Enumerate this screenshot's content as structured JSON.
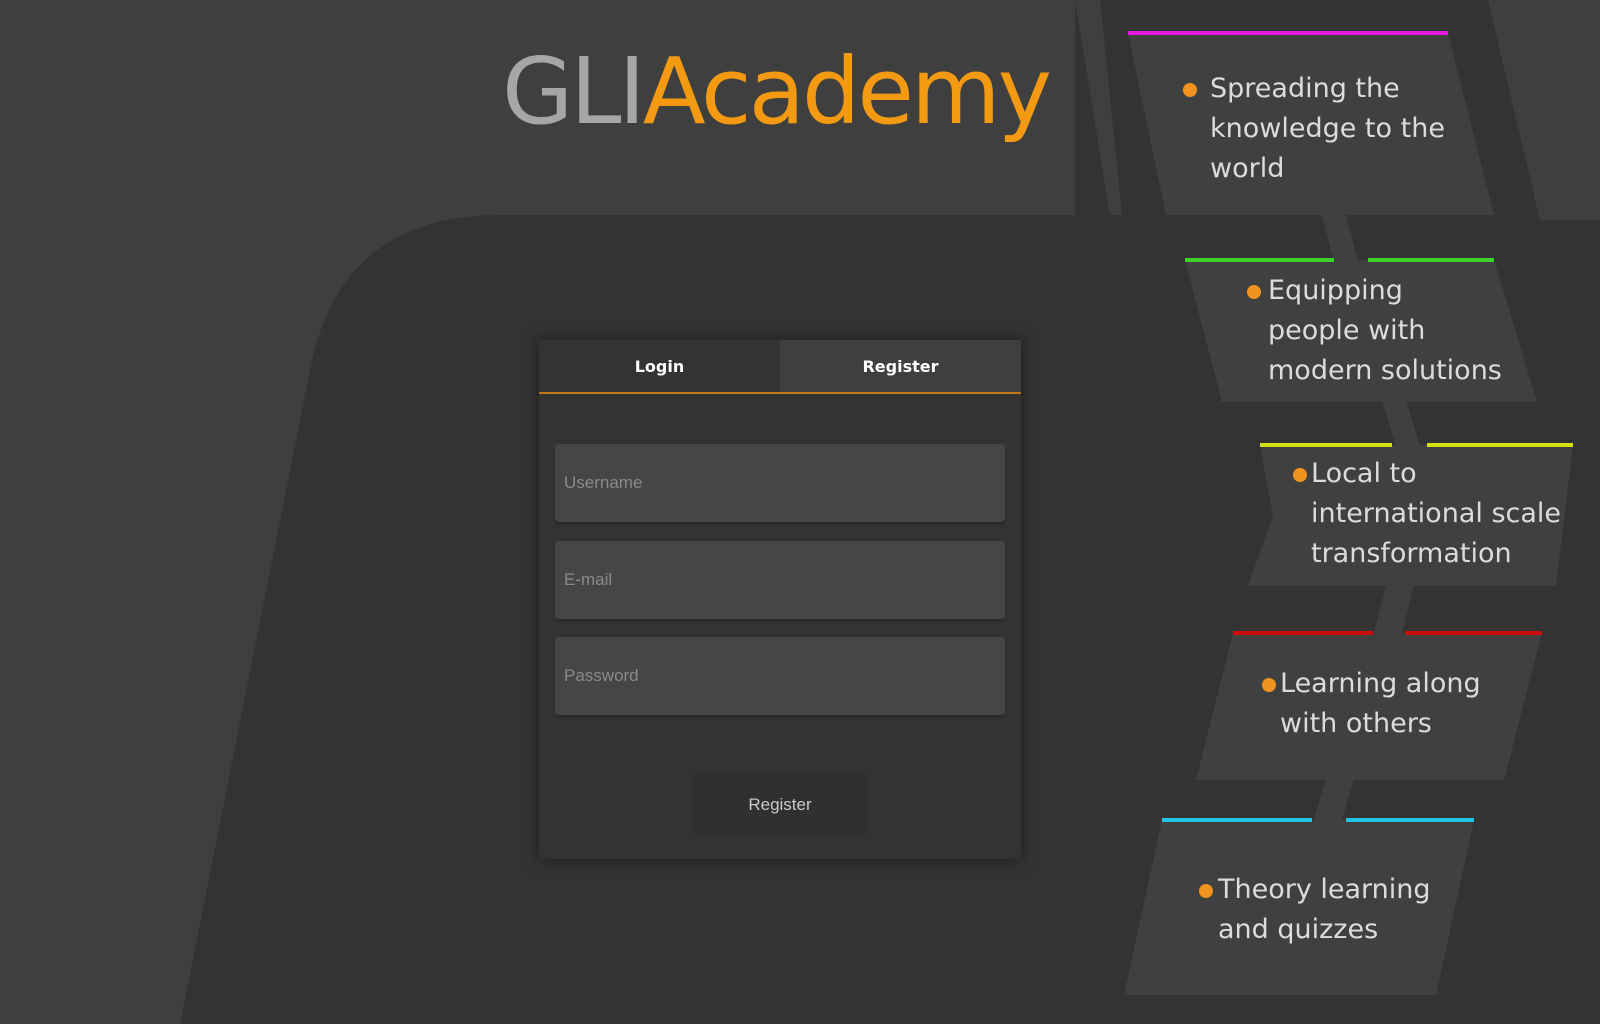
{
  "brand": {
    "logo_part1": "GLI",
    "logo_part2": "Academy",
    "accent_color": "#f39a12"
  },
  "auth": {
    "tabs": [
      {
        "label": "Login",
        "active": false
      },
      {
        "label": "Register",
        "active": true
      }
    ],
    "fields": {
      "username_placeholder": "Username",
      "email_placeholder": "E-mail",
      "password_placeholder": "Password"
    },
    "submit_label": "Register",
    "tab_underline_color": "#c07716"
  },
  "features": [
    {
      "lines": [
        "Spreading the",
        "knowledge to the",
        "world"
      ],
      "stripe_color": "#e21cdc"
    },
    {
      "lines": [
        "Equipping",
        "people with",
        "modern solutions"
      ],
      "stripe_color": "#3dd12a"
    },
    {
      "lines": [
        "Local to",
        "international scale",
        "transformation"
      ],
      "stripe_color": "#d6e017"
    },
    {
      "lines": [
        "Learning along",
        "with others"
      ],
      "stripe_color": "#cc0d0d"
    },
    {
      "lines": [
        "Theory learning",
        "and quizzes"
      ],
      "stripe_color": "#1fc6e6"
    }
  ],
  "colors": {
    "background": "#3f3f3f",
    "panel_dark": "#333333",
    "block_fill": "#404040",
    "bullet": "#f0941f"
  }
}
